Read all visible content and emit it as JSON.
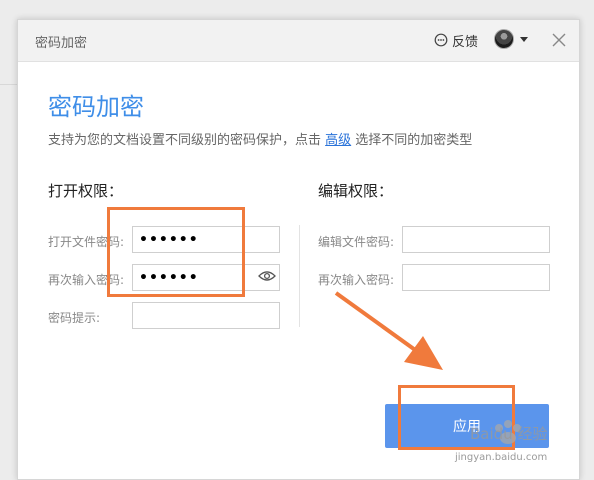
{
  "window": {
    "title": "密码加密"
  },
  "header": {
    "feedback_label": "反馈"
  },
  "heading": "密码加密",
  "description": {
    "before_link": "支持为您的文档设置不同级别的密码保护，点击 ",
    "link": "高级",
    "after_link": " 选择不同的加密类型"
  },
  "open_permission": {
    "title": "打开权限：",
    "password_label": "打开文件密码:",
    "password_value": "••••••",
    "confirm_label": "再次输入密码:",
    "confirm_value": "••••••",
    "hint_label": "密码提示:",
    "hint_value": ""
  },
  "edit_permission": {
    "title": "编辑权限：",
    "password_label": "编辑文件密码:",
    "password_value": "",
    "confirm_label": "再次输入密码:",
    "confirm_value": ""
  },
  "apply_label": "应用",
  "watermark": {
    "brand": "Baidu 经验",
    "url": "jingyan.baidu.com"
  },
  "colors": {
    "accent": "#3f8ee8",
    "button": "#5b95ec",
    "annotation": "#f07a3c"
  },
  "icons": [
    "feedback-icon",
    "avatar",
    "chevron-down-icon",
    "close-icon",
    "eye-icon"
  ]
}
